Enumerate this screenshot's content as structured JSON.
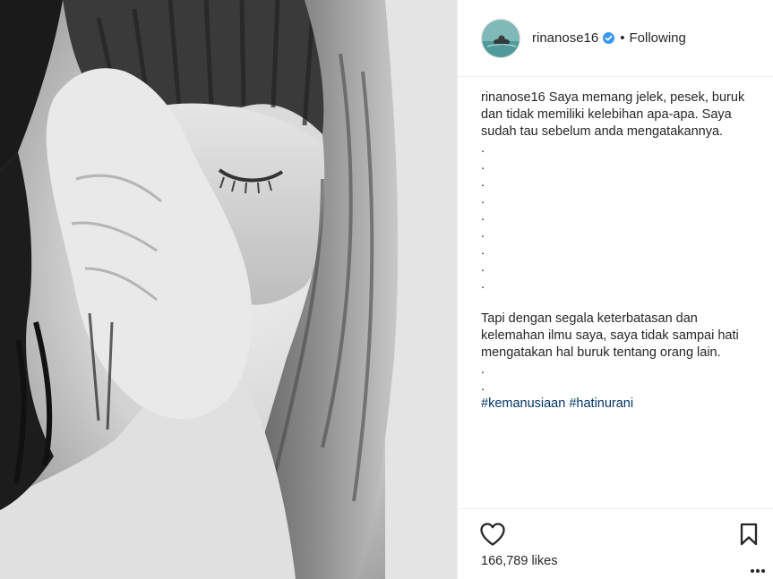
{
  "post": {
    "username": "rinanose16",
    "separator": "•",
    "follow_status": "Following",
    "caption": {
      "username": "rinanose16",
      "lines": [
        "Saya memang jelek, pesek, buruk dan tidak memiliki kelebihan apa-apa. Saya sudah tau sebelum anda mengatakannya.",
        ".",
        ".",
        ".",
        ".",
        ".",
        ".",
        ".",
        ".",
        ".",
        "",
        "Tapi dengan segala keterbatasan dan kelemahan ilmu saya, saya tidak sampai hati mengatakan hal buruk tentang orang lain.",
        ".",
        "."
      ],
      "hashtags": "#kemanusiaan #hatinurani"
    },
    "likes": "166,789 likes"
  },
  "colors": {
    "hashtag": "#003569",
    "text": "#262626",
    "verified_badge": "#3897f0",
    "border": "#efefef"
  },
  "icons": {
    "like": "heart-icon",
    "save": "bookmark-icon",
    "verified": "verified-badge-icon",
    "more": "more-options-icon"
  }
}
